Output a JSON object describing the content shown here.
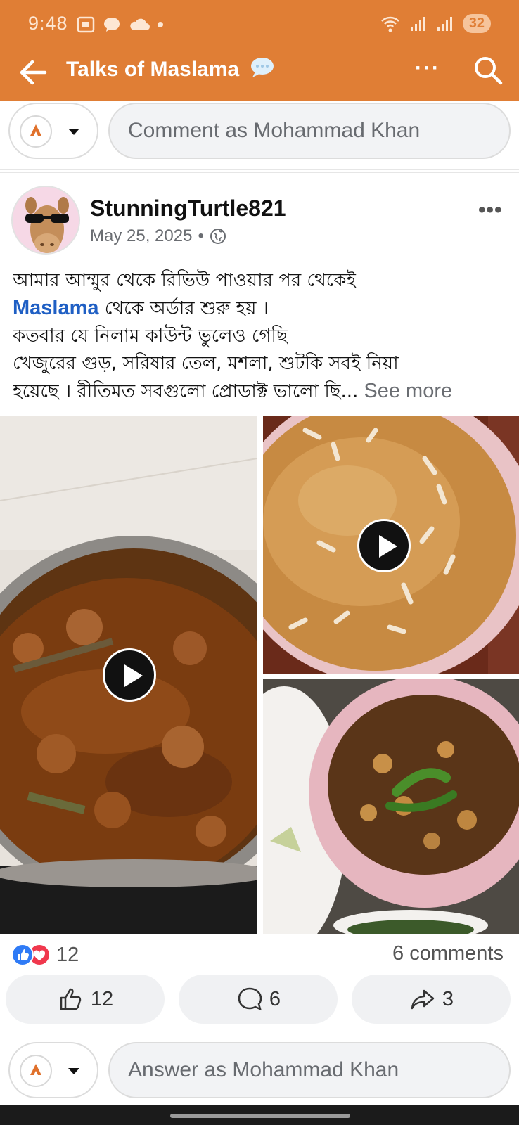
{
  "status_bar": {
    "time": "9:48",
    "battery": "32"
  },
  "header": {
    "title": "Talks of Maslama",
    "more_label": "···"
  },
  "composer_top": {
    "placeholder": "Comment as Mohammad Khan"
  },
  "post": {
    "author": "StunningTurtle821",
    "date": "May 25, 2025",
    "date_separator": "•",
    "more_label": "•••",
    "text_line1": "আমার আম্মুর থেকে রিভিউ পাওয়ার পর থেকেই",
    "link": "Maslama",
    "text_line2_rest": " থেকে অর্ডার শুরু হয় ।",
    "text_line3": "কতবার যে নিলাম কাউন্ট ভুলেও গেছি",
    "text_line4": "খেজুরের গুড়, সরিষার তেল, মশলা, শুটকি সবই নিয়া",
    "text_line5": "হয়েছে । রীতিমত সবগুলো প্রোডাক্ট ভালো ছি...",
    "see_more": " See more",
    "media": [
      {
        "label": "curry-video"
      },
      {
        "label": "halwa-video"
      },
      {
        "label": "shrimp-curry-photo"
      }
    ]
  },
  "reactions": {
    "count": "12",
    "comments": "6 comments"
  },
  "actions": {
    "like": "12",
    "comment": "6",
    "share": "3"
  },
  "composer_bottom": {
    "placeholder": "Answer as Mohammad Khan"
  },
  "colors": {
    "brand": "#e07e35",
    "link": "#1f5fc4",
    "upvote": "#e0712c"
  }
}
